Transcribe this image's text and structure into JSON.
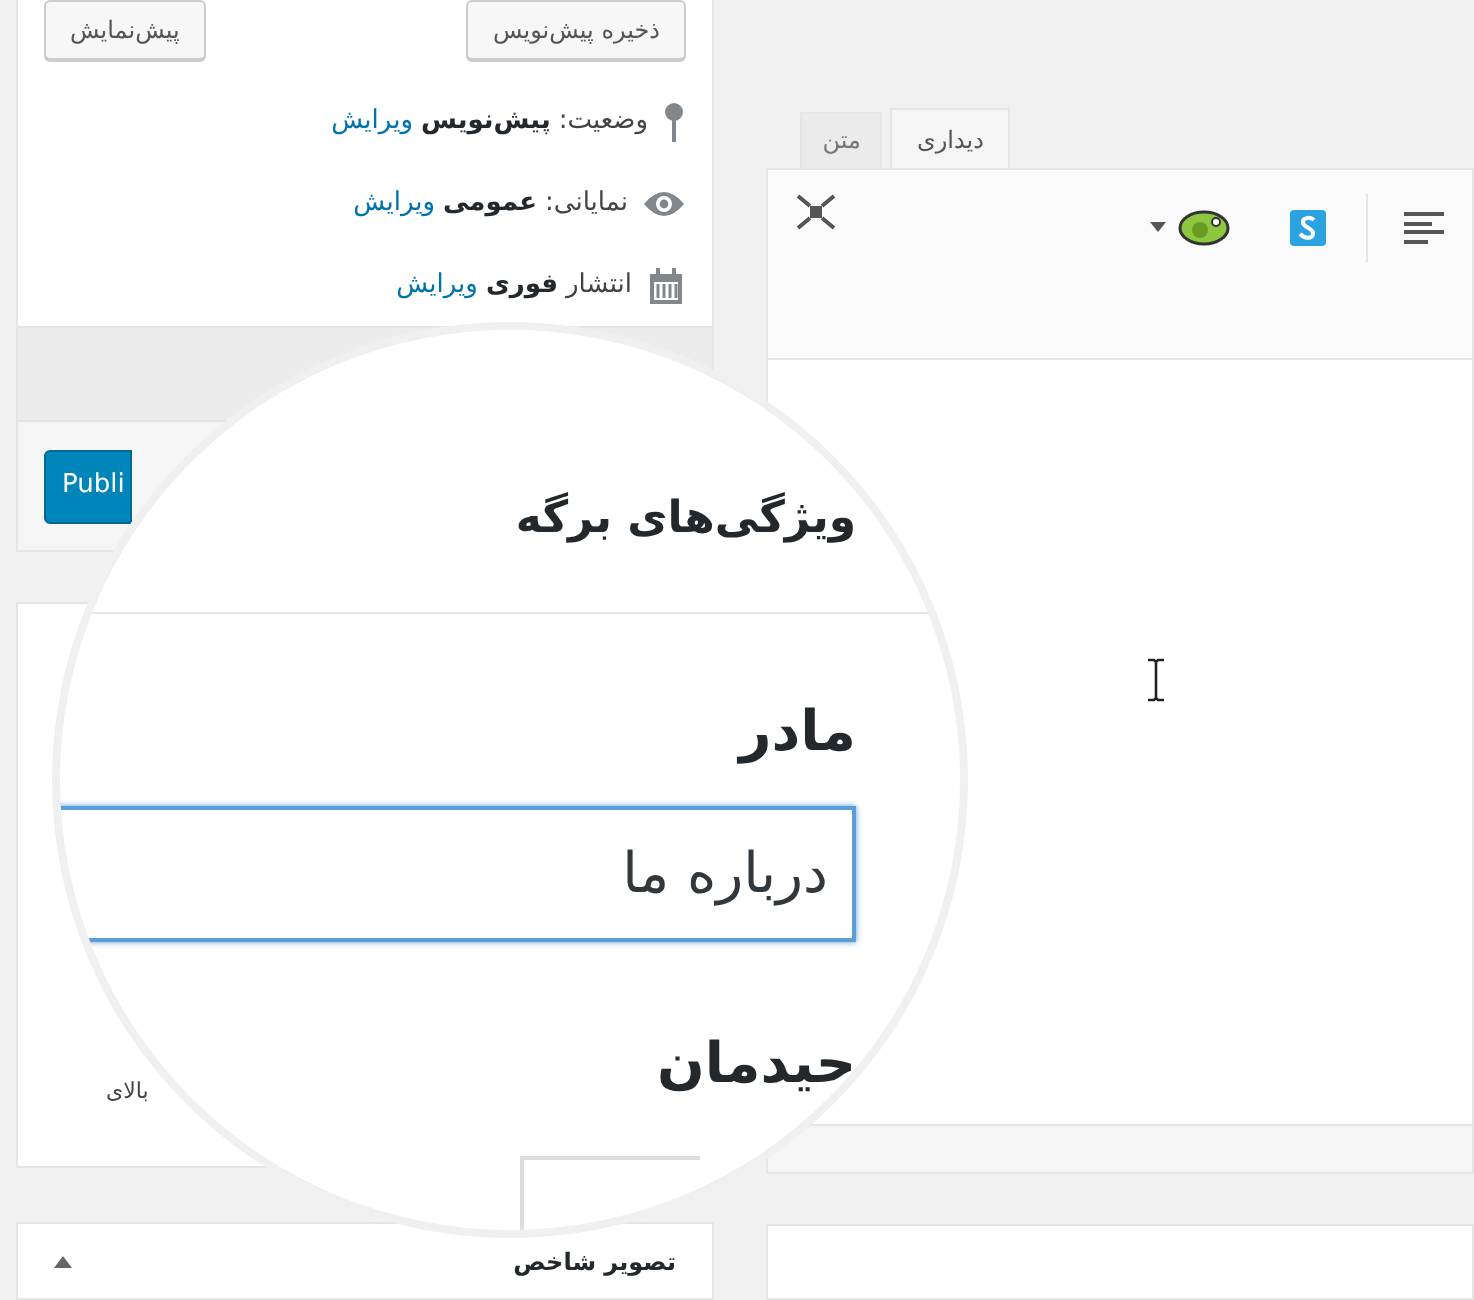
{
  "publish_box": {
    "buttons": [
      {
        "label": "ذخیره پیش‌نویس"
      },
      {
        "label": "پیش‌نمایش"
      }
    ],
    "rows": [
      {
        "kind": "status",
        "label": "وضعیت:",
        "value": "پیش‌نویس",
        "link": "ویرایش"
      },
      {
        "kind": "visibility",
        "label": "نمایانی:",
        "value": "عمومی",
        "link": "ویرایش"
      },
      {
        "kind": "schedule",
        "label": "انتشار",
        "value": "فوری",
        "link": "ویرایش"
      }
    ],
    "publish_button": "Publi"
  },
  "editor": {
    "tabs": [
      {
        "label": "دیداری",
        "selected": true
      },
      {
        "label": "متن",
        "selected": false
      }
    ]
  },
  "page_attributes_box": {
    "partial_text": "بالای"
  },
  "featured_image_box": {
    "title": "تصویر شاخص"
  },
  "magnifier": {
    "heading": "ویژگی‌های برگه",
    "parent_label": "مادر",
    "parent_value": "درباره ما",
    "template_label": "حیدمان"
  }
}
